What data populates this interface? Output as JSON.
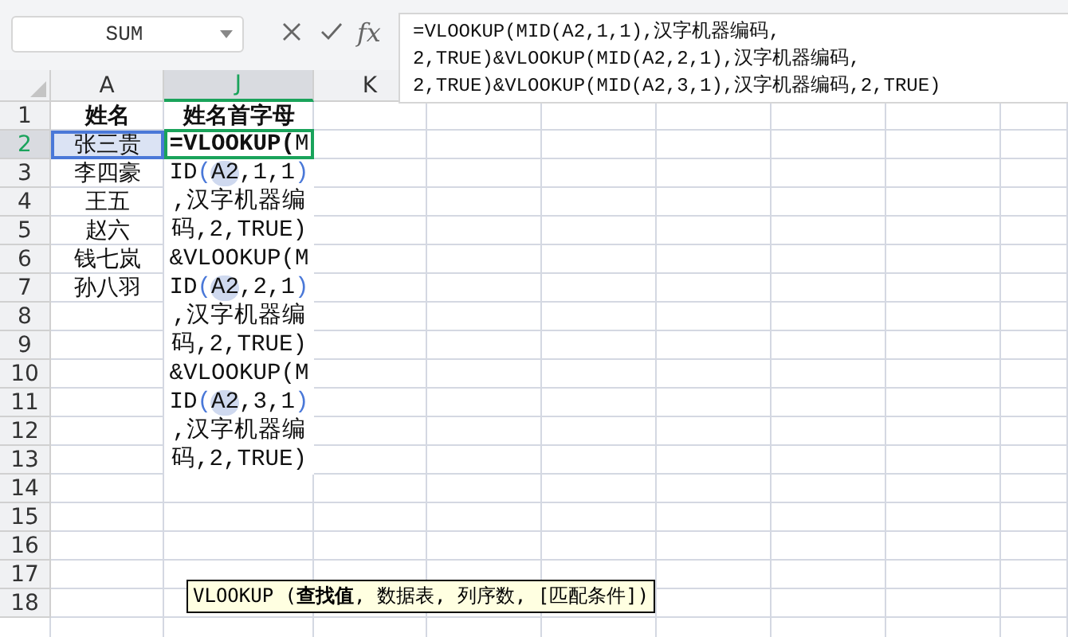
{
  "name_box": {
    "value": "SUM"
  },
  "formula_bar": {
    "fx_label": "fx",
    "lines": [
      "=VLOOKUP(MID(A2,1,1),汉字机器编码,",
      "2,TRUE)&VLOOKUP(MID(A2,2,1),汉字机器编码,",
      "2,TRUE)&VLOOKUP(MID(A2,3,1),汉字机器编码,2,TRUE)"
    ]
  },
  "columns": [
    {
      "label": "A",
      "selected": false
    },
    {
      "label": "J",
      "selected": true
    },
    {
      "label": "K",
      "selected": false
    }
  ],
  "rows": [
    {
      "label": "1",
      "selected": false,
      "cells": [
        "姓名",
        "姓名首字母"
      ]
    },
    {
      "label": "2",
      "selected": true,
      "cells": [
        "张三贵",
        ""
      ]
    },
    {
      "label": "3",
      "selected": false,
      "cells": [
        "李四豪",
        ""
      ]
    },
    {
      "label": "4",
      "selected": false,
      "cells": [
        "王五",
        ""
      ]
    },
    {
      "label": "5",
      "selected": false,
      "cells": [
        "赵六",
        ""
      ]
    },
    {
      "label": "6",
      "selected": false,
      "cells": [
        "钱七岚",
        ""
      ]
    },
    {
      "label": "7",
      "selected": false,
      "cells": [
        "孙八羽",
        ""
      ]
    },
    {
      "label": "8",
      "selected": false,
      "cells": [
        "",
        ""
      ]
    },
    {
      "label": "9",
      "selected": false,
      "cells": [
        "",
        ""
      ]
    },
    {
      "label": "10",
      "selected": false,
      "cells": [
        "",
        ""
      ]
    },
    {
      "label": "11",
      "selected": false,
      "cells": [
        "",
        ""
      ]
    },
    {
      "label": "12",
      "selected": false,
      "cells": [
        "",
        ""
      ]
    },
    {
      "label": "13",
      "selected": false,
      "cells": [
        "",
        ""
      ]
    },
    {
      "label": "14",
      "selected": false,
      "cells": [
        "",
        ""
      ]
    },
    {
      "label": "15",
      "selected": false,
      "cells": [
        "",
        ""
      ]
    },
    {
      "label": "16",
      "selected": false,
      "cells": [
        "",
        ""
      ]
    },
    {
      "label": "17",
      "selected": false,
      "cells": [
        "",
        ""
      ]
    },
    {
      "label": "18",
      "selected": false,
      "cells": [
        "",
        ""
      ]
    }
  ],
  "cell_editor": {
    "segments": [
      {
        "kind": "func",
        "text": "=VLOOKUP("
      },
      {
        "kind": "plain",
        "text": "MID"
      },
      {
        "kind": "paren",
        "text": "("
      },
      {
        "kind": "ref",
        "text": "A2"
      },
      {
        "kind": "plain",
        "text": ",1,1"
      },
      {
        "kind": "paren",
        "text": ")"
      },
      {
        "kind": "plain",
        "text": ",汉字机器编码,2,TRUE)&VLOOKUP(MID"
      },
      {
        "kind": "paren",
        "text": "("
      },
      {
        "kind": "ref",
        "text": "A2"
      },
      {
        "kind": "plain",
        "text": ",2,1"
      },
      {
        "kind": "paren",
        "text": ")"
      },
      {
        "kind": "plain",
        "text": ",汉字机器编码,2,TRUE)&VLOOKUP(MID"
      },
      {
        "kind": "paren",
        "text": "("
      },
      {
        "kind": "ref",
        "text": "A2"
      },
      {
        "kind": "plain",
        "text": ",3,1"
      },
      {
        "kind": "paren",
        "text": ")"
      },
      {
        "kind": "plain",
        "text": ",汉字机器编码,2,TRUE)"
      }
    ]
  },
  "tooltip": {
    "text": "VLOOKUP (**查找值**, 数据表, 列序数, [匹配条件])"
  }
}
